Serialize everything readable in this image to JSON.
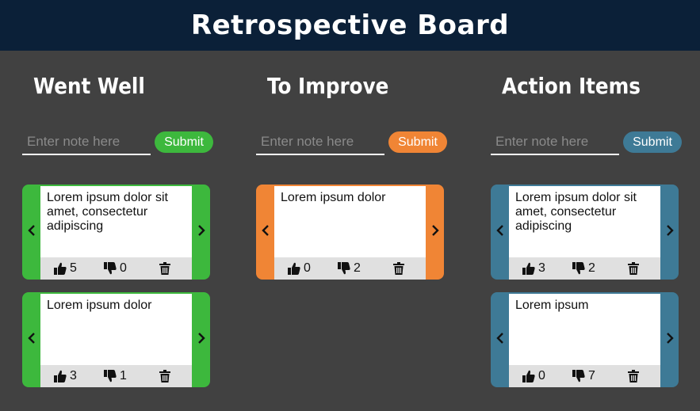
{
  "header": {
    "title": "Retrospective Board"
  },
  "columns": [
    {
      "title": "Went Well",
      "color": "#3db83d",
      "placeholder": "Enter note here",
      "submit_label": "Submit",
      "cards": [
        {
          "text": "Lorem ipsum dolor sit amet, consectetur adipiscing",
          "likes": "5",
          "dislikes": "0"
        },
        {
          "text": "Lorem ipsum dolor",
          "likes": "3",
          "dislikes": "1"
        }
      ]
    },
    {
      "title": "To Improve",
      "color": "#f08535",
      "placeholder": "Enter note here",
      "submit_label": "Submit",
      "cards": [
        {
          "text": "Lorem ipsum dolor",
          "likes": "0",
          "dislikes": "2"
        }
      ]
    },
    {
      "title": "Action Items",
      "color": "#3e7a96",
      "placeholder": "Enter note here",
      "submit_label": "Submit",
      "cards": [
        {
          "text": "Lorem ipsum dolor sit amet, consectetur adipiscing",
          "likes": "3",
          "dislikes": "2"
        },
        {
          "text": "Lorem ipsum",
          "likes": "0",
          "dislikes": "7"
        }
      ]
    }
  ],
  "icons": {
    "prev": "chevron-left-icon",
    "next": "chevron-right-icon",
    "like": "thumbs-up-icon",
    "dislike": "thumbs-down-icon",
    "delete": "trash-icon"
  }
}
